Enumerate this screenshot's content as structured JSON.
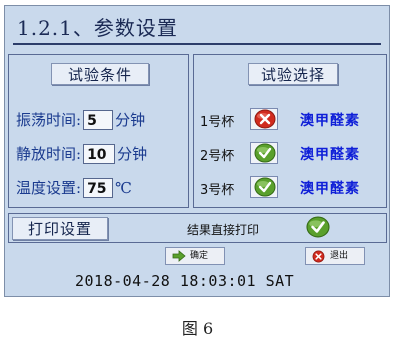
{
  "screen": {
    "title": "1.2.1、参数设置"
  },
  "test_conditions": {
    "header": "试验条件",
    "params": [
      {
        "label": "振荡时间:",
        "value": "5",
        "unit": "分钟"
      },
      {
        "label": "静放时间:",
        "value": "10",
        "unit": "分钟"
      },
      {
        "label": "温度设置:",
        "value": "75",
        "unit": "℃"
      }
    ]
  },
  "test_selection": {
    "header": "试验选择",
    "cups": [
      {
        "label": "1号杯",
        "state": "unchecked",
        "test": "澳甲醛素"
      },
      {
        "label": "2号杯",
        "state": "checked",
        "test": "澳甲醛素"
      },
      {
        "label": "3号杯",
        "state": "checked",
        "test": "澳甲醛素"
      }
    ]
  },
  "print": {
    "header": "打印设置",
    "option_text": "结果直接打印",
    "state": "checked"
  },
  "buttons": {
    "confirm": "确定",
    "back": "退出"
  },
  "status": {
    "datetime": "2018-04-28 18:03:01 SAT"
  },
  "caption": "图 6",
  "colors": {
    "screen_bg": "#c9d9ec",
    "check_green": "#5aa02c",
    "cross_red": "#d02a1e",
    "test_blue": "#1020d8"
  }
}
